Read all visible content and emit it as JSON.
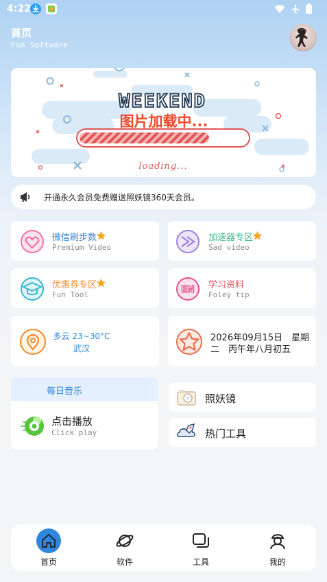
{
  "status_bar": {
    "time": "4:22",
    "icons": [
      "download-app-icon",
      "gallery-app-icon",
      "wifi-icon",
      "airplane-icon",
      "battery-icon"
    ]
  },
  "header": {
    "title": "首页",
    "subtitle": "Fun Software",
    "avatar": "user-avatar"
  },
  "banner": {
    "headline": "WEEKEND",
    "loading_text": "图片加载中...",
    "loading_caption": "loading...",
    "progress_fraction": 0.86
  },
  "notice": {
    "icon": "megaphone-icon",
    "text": "开通永久会员免费赠送照妖镜360天会员。"
  },
  "tiles": [
    {
      "title": "微信刷步数",
      "subtitle": "Premium Video",
      "icon": "heart-icon",
      "color": "#f26fa6",
      "starred": true
    },
    {
      "title": "加速器专区",
      "subtitle": "Sad video",
      "icon": "speed-icon",
      "color": "#3fb98d",
      "starred": true
    },
    {
      "title": "优惠券专区",
      "subtitle": "Fun Tool",
      "icon": "graduation-cap-icon",
      "color": "#ef8b2c",
      "starred": true
    },
    {
      "title": "学习资料",
      "subtitle": "Foley tip",
      "icon": "en-icon",
      "color": "#e0525c",
      "starred": false
    }
  ],
  "weather": {
    "line1": "多云 23~30°C",
    "line2": "武汉",
    "icon": "location-pin-icon",
    "color": "#2e86de"
  },
  "date": {
    "line1": "2026年09月15日　星期",
    "line2": "二　丙午年八月初五",
    "icon": "star-badge-icon"
  },
  "music": {
    "header": "每日音乐",
    "title": "点击播放",
    "subtitle": "Click play",
    "icon": "music-disc-icon"
  },
  "side_tools": [
    {
      "label": "照妖镜",
      "icon": "camera-icon"
    },
    {
      "label": "热门工具",
      "icon": "rocket-cloud-icon"
    }
  ],
  "nav": [
    {
      "label": "首页",
      "icon": "home-icon",
      "active": true
    },
    {
      "label": "软件",
      "icon": "planet-icon",
      "active": false
    },
    {
      "label": "工具",
      "icon": "tools-icon",
      "active": false
    },
    {
      "label": "我的",
      "icon": "profile-icon",
      "active": false
    }
  ],
  "colors": {
    "accent": "#2e86de",
    "star": "#f5a623",
    "tile_weather": "#ef8b2c",
    "date_star": "#f06b4a",
    "active_nav": "#2e86de"
  }
}
